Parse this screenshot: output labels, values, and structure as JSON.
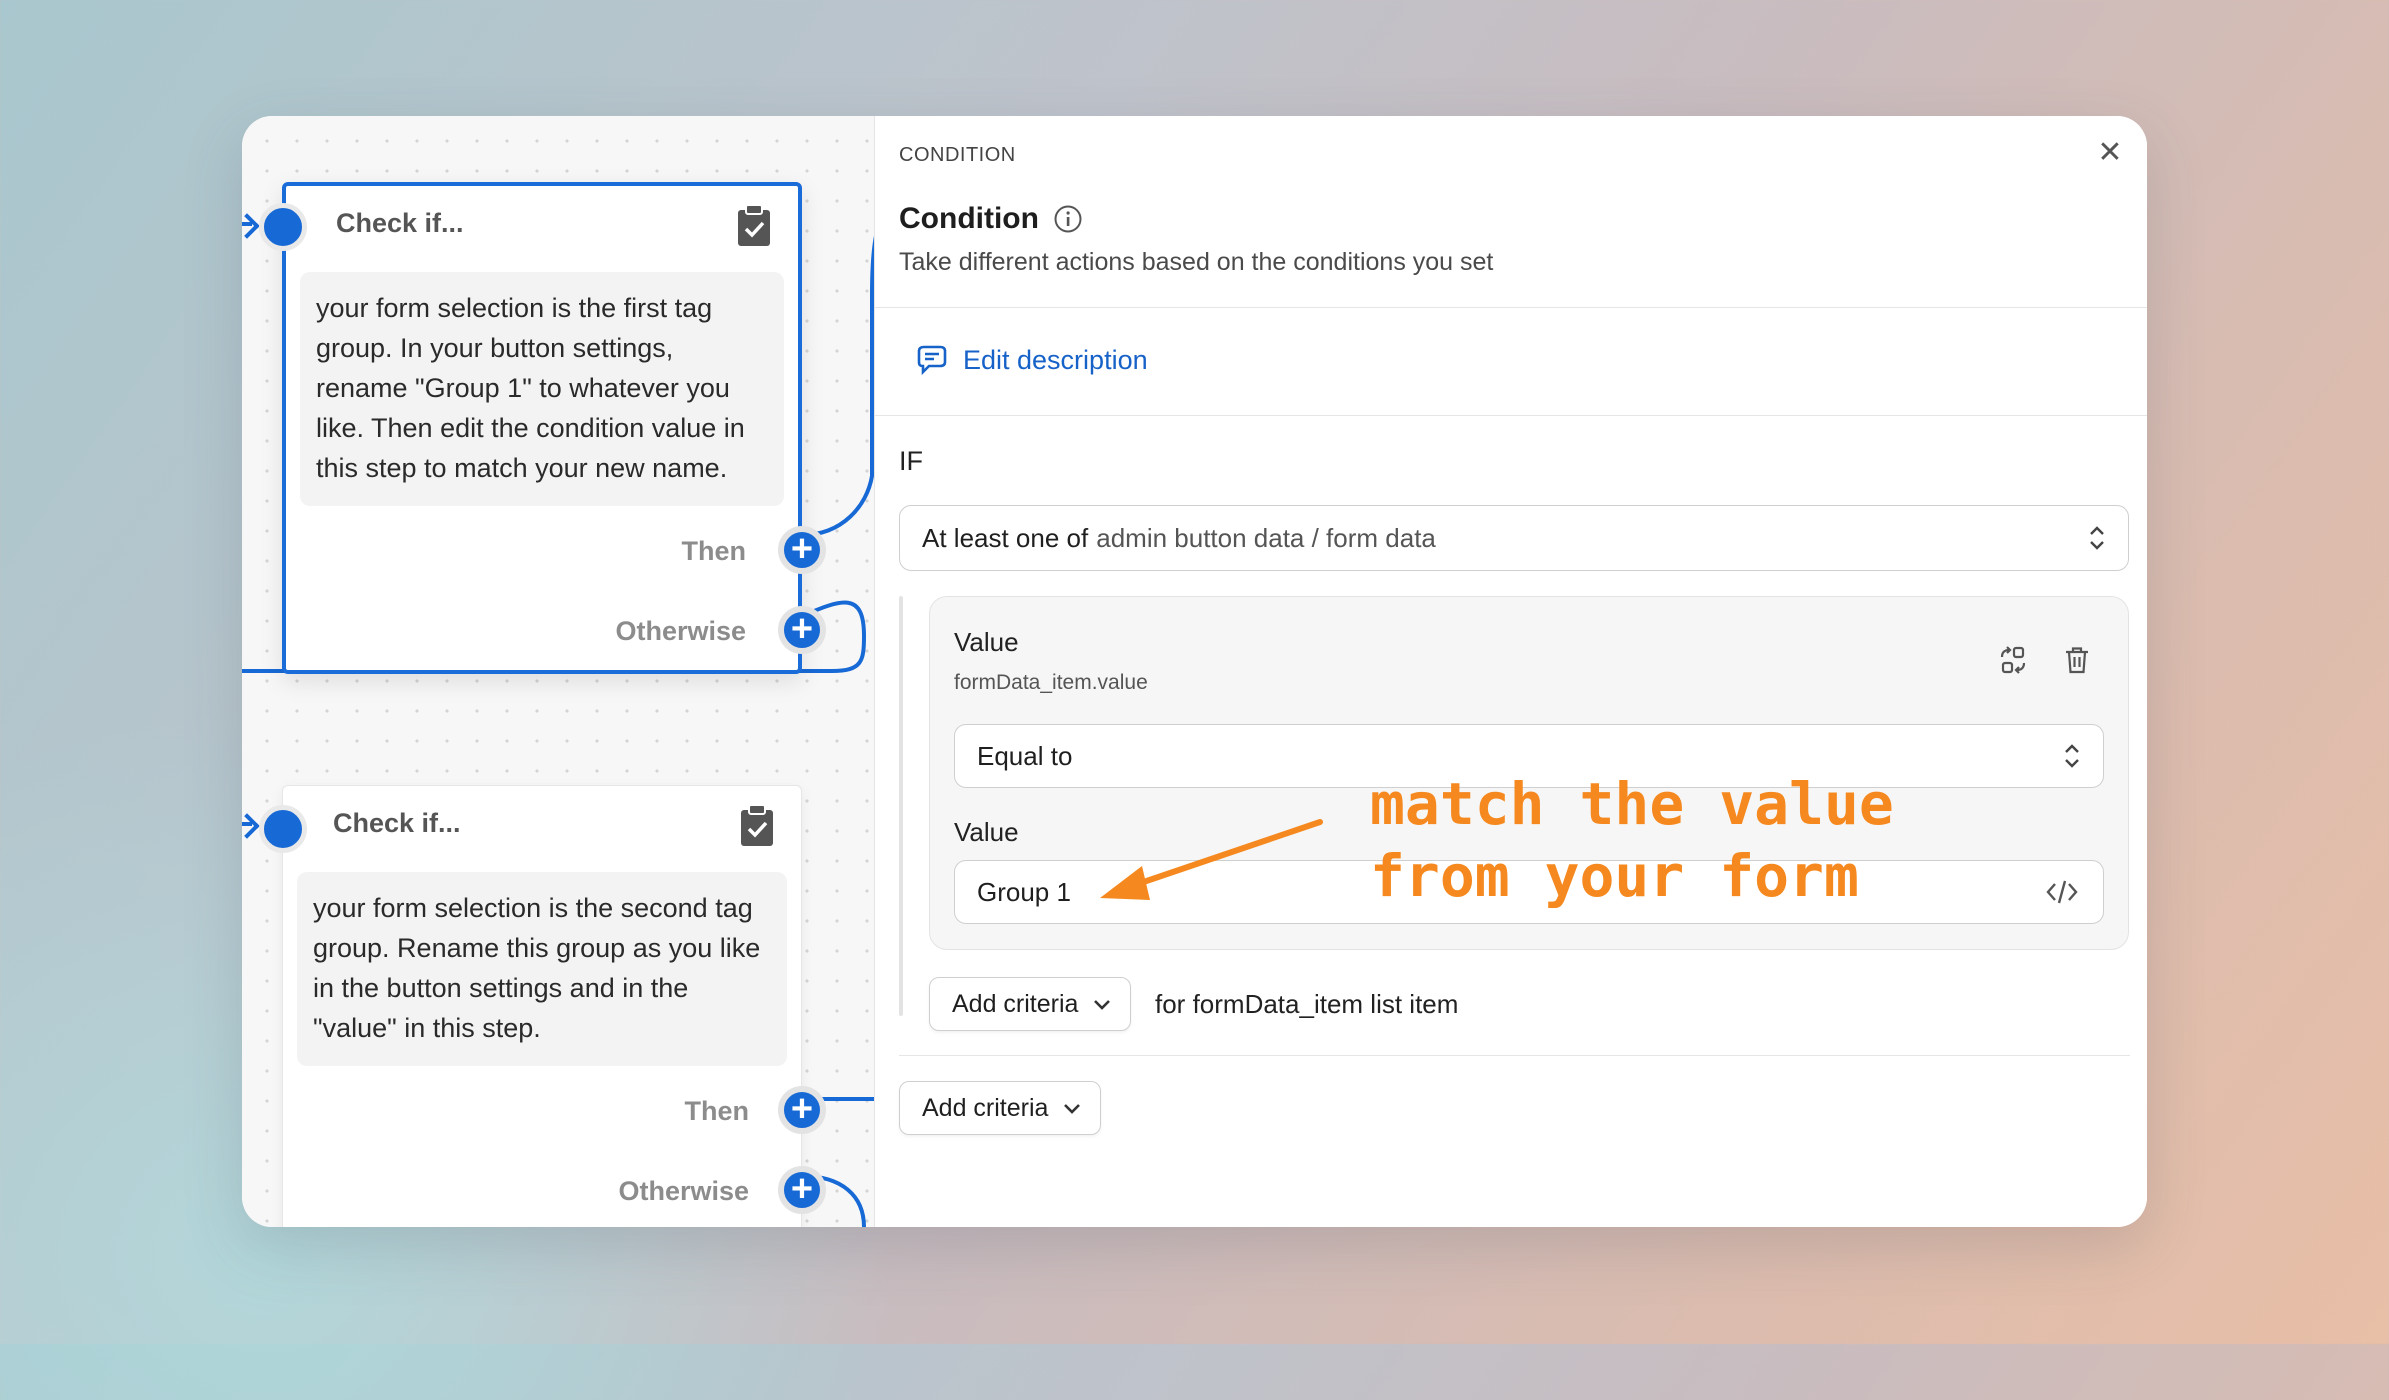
{
  "canvas": {
    "nodes": [
      {
        "title": "Check if...",
        "icon": "clipboard-check-icon",
        "body": "your form selection is the first tag group. In your button settings, rename \"Group 1\" to whatever you like. Then edit the condition value in this step to match your new name.",
        "then_label": "Then",
        "otherwise_label": "Otherwise"
      },
      {
        "title": "Check if...",
        "icon": "clipboard-check-icon",
        "body": "your form selection is the second tag group. Rename this group as you like in the button settings and in the \"value\" in this step.",
        "then_label": "Then",
        "otherwise_label": "Otherwise"
      }
    ]
  },
  "panel": {
    "eyebrow": "CONDITION",
    "title": "Condition",
    "subtitle": "Take different actions based on the conditions you set",
    "edit_description": "Edit description",
    "if_label": "IF",
    "scope_select": {
      "prefix": "At least one of",
      "source": "admin button data / form data"
    },
    "criteria": {
      "label": "Value",
      "path": "formData_item.value",
      "operator": "Equal to",
      "value_label": "Value",
      "value": "Group 1"
    },
    "add_criteria_inner": "Add criteria",
    "for_text": "for formData_item list item",
    "add_criteria_outer": "Add criteria"
  },
  "annotation": {
    "text": "match the value\nfrom your form",
    "color": "#f5891f"
  },
  "colors": {
    "accent": "#1769d6",
    "link": "#1662c8"
  }
}
